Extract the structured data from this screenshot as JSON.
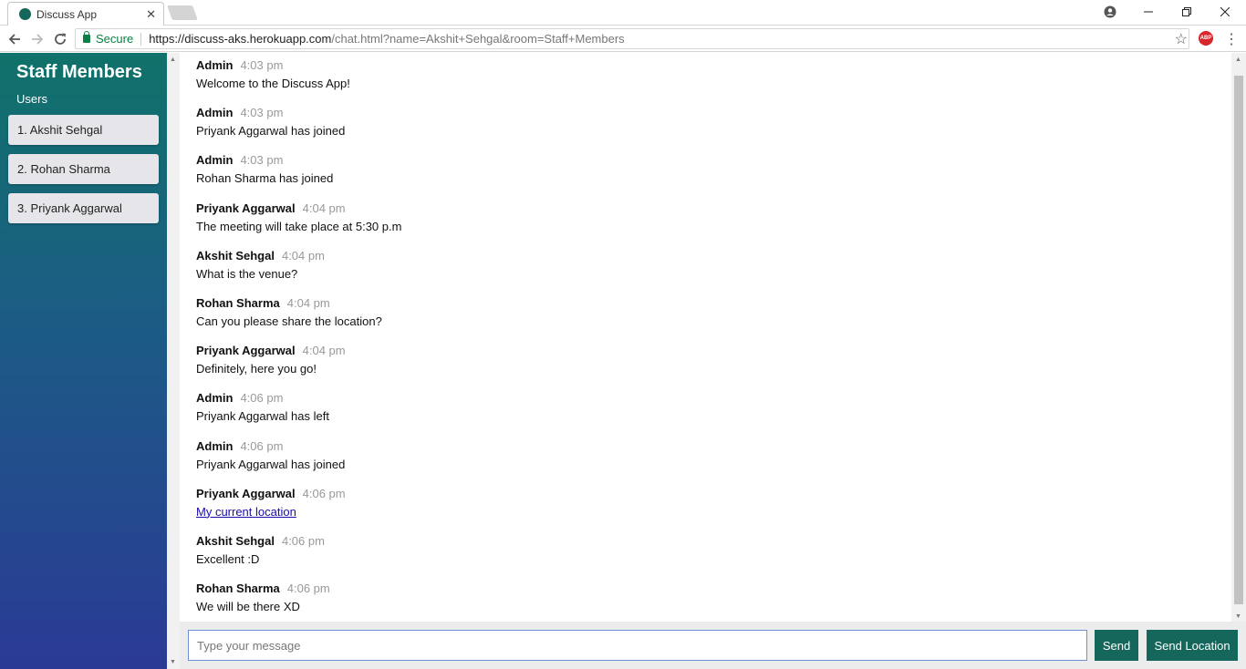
{
  "browser": {
    "tab_title": "Discuss App",
    "tab_close": "✕",
    "secure_label": "Secure",
    "url_host": "https://discuss-aks.herokuapp.com",
    "url_rest": "/chat.html?name=Akshit+Sehgal&room=Staff+Members"
  },
  "sidebar": {
    "room_title": "Staff Members",
    "users_label": "Users",
    "users": [
      "1. Akshit Sehgal",
      "2. Rohan Sharma",
      "3. Priyank Aggarwal"
    ]
  },
  "messages": [
    {
      "name": "Admin",
      "time": "4:03 pm",
      "text": "Welcome to the Discuss App!"
    },
    {
      "name": "Admin",
      "time": "4:03 pm",
      "text": "Priyank Aggarwal has joined"
    },
    {
      "name": "Admin",
      "time": "4:03 pm",
      "text": "Rohan Sharma has joined"
    },
    {
      "name": "Priyank Aggarwal",
      "time": "4:04 pm",
      "text": "The meeting will take place at 5:30 p.m"
    },
    {
      "name": "Akshit Sehgal",
      "time": "4:04 pm",
      "text": "What is the venue?"
    },
    {
      "name": "Rohan Sharma",
      "time": "4:04 pm",
      "text": "Can you please share the location?"
    },
    {
      "name": "Priyank Aggarwal",
      "time": "4:04 pm",
      "text": "Definitely, here you go!"
    },
    {
      "name": "Admin",
      "time": "4:06 pm",
      "text": "Priyank Aggarwal has left"
    },
    {
      "name": "Admin",
      "time": "4:06 pm",
      "text": "Priyank Aggarwal has joined"
    },
    {
      "name": "Priyank Aggarwal",
      "time": "4:06 pm",
      "link": "My current location"
    },
    {
      "name": "Akshit Sehgal",
      "time": "4:06 pm",
      "text": "Excellent :D"
    },
    {
      "name": "Rohan Sharma",
      "time": "4:06 pm",
      "text": "We will be there XD"
    }
  ],
  "composer": {
    "placeholder": "Type your message",
    "send_label": "Send",
    "send_location_label": "Send Location"
  },
  "colors": {
    "accent": "#14675a",
    "link": "#1a0dab"
  }
}
